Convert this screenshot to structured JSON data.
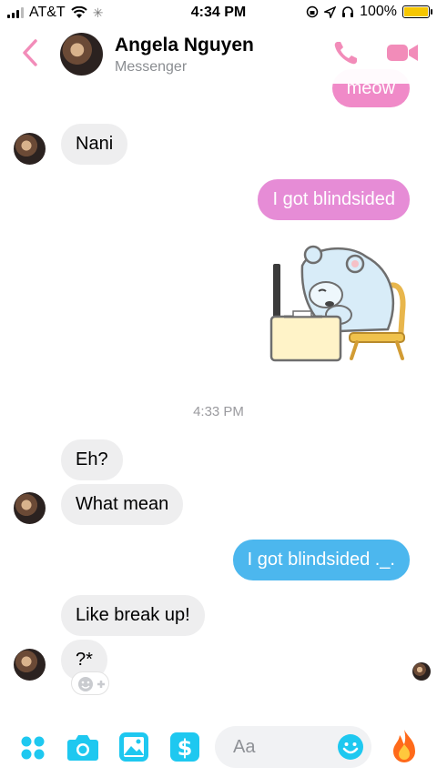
{
  "status_bar": {
    "carrier": "AT&T",
    "time": "4:34 PM",
    "battery": "100%"
  },
  "header": {
    "contact_name": "Angela Nguyen",
    "subtitle": "Messenger"
  },
  "messages": [
    {
      "id": "m1",
      "direction": "outgoing",
      "text": "meow",
      "color": "#f08ac8"
    },
    {
      "id": "m2",
      "direction": "incoming",
      "text": "Nani"
    },
    {
      "id": "m3",
      "direction": "outgoing",
      "text": "I got blindsided",
      "color": "#e68cd6"
    },
    {
      "id": "m4",
      "direction": "outgoing",
      "type": "sticker",
      "sticker": "sleeping-bear-at-desk-sticker"
    },
    {
      "id": "m5",
      "direction": "incoming",
      "text": "Eh?"
    },
    {
      "id": "m6",
      "direction": "incoming",
      "text": "What mean"
    },
    {
      "id": "m7",
      "direction": "outgoing",
      "text": "I got blindsided ._.",
      "color": "#4cb7ee"
    },
    {
      "id": "m8",
      "direction": "incoming",
      "text": "Like break up!"
    },
    {
      "id": "m9",
      "direction": "incoming",
      "text": "?*"
    }
  ],
  "timestamp_divider": "4:33 PM",
  "composer": {
    "placeholder": "Aa",
    "accent_color": "#1ec8f0"
  },
  "colors": {
    "header_accent": "#f28cb9",
    "incoming_bubble": "#eeeeef"
  }
}
